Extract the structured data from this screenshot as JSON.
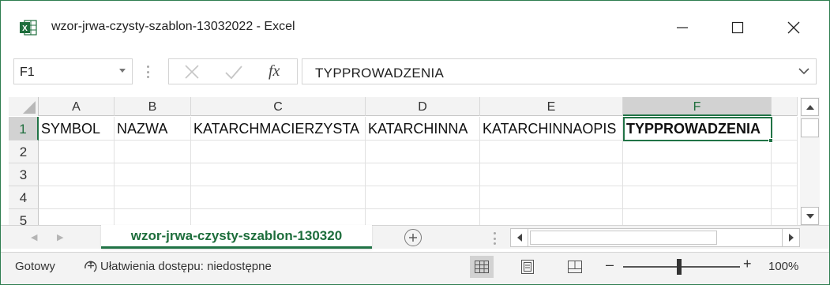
{
  "window": {
    "title": "wzor-jrwa-czysty-szablon-13032022 - Excel",
    "accent_color": "#217346",
    "app_icon": "excel-icon"
  },
  "formula_bar": {
    "name_box": "F1",
    "content": "TYPPROWADZENIA",
    "fx_label": "fx"
  },
  "grid": {
    "columns": [
      "A",
      "B",
      "C",
      "D",
      "E",
      "F"
    ],
    "selected_column": "F",
    "rows": [
      "1",
      "2",
      "3",
      "4",
      "5"
    ],
    "selected_row": "1",
    "row1_cells": [
      "SYMBOL",
      "NAZWA",
      "KATARCHMACIERZYSTA",
      "KATARCHINNA",
      "KATARCHINNAOPIS",
      "TYPPROWADZENIA"
    ],
    "active_cell": "F1"
  },
  "sheet_tabs": {
    "active_tab": "wzor-jrwa-czysty-szablon-130320"
  },
  "status_bar": {
    "ready": "Gotowy",
    "accessibility": "Ułatwienia dostępu: niedostępne",
    "zoom": "100%"
  }
}
